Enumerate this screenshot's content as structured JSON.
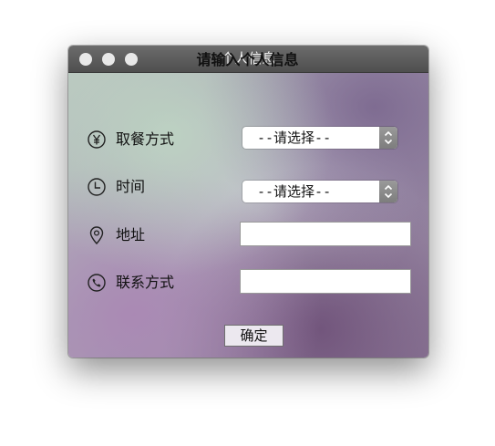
{
  "window": {
    "title": "个人信息"
  },
  "form": {
    "heading": "请输入个人信息",
    "meal_method": {
      "label": "取餐方式",
      "icon": "yen-circle-icon",
      "selected": "--请选择--"
    },
    "time": {
      "label": "时间",
      "icon": "clock-icon",
      "selected": "--请选择--"
    },
    "address": {
      "label": "地址",
      "icon": "location-pin-icon",
      "value": ""
    },
    "contact": {
      "label": "联系方式",
      "icon": "phone-circle-icon",
      "value": ""
    },
    "confirm_label": "确定"
  }
}
